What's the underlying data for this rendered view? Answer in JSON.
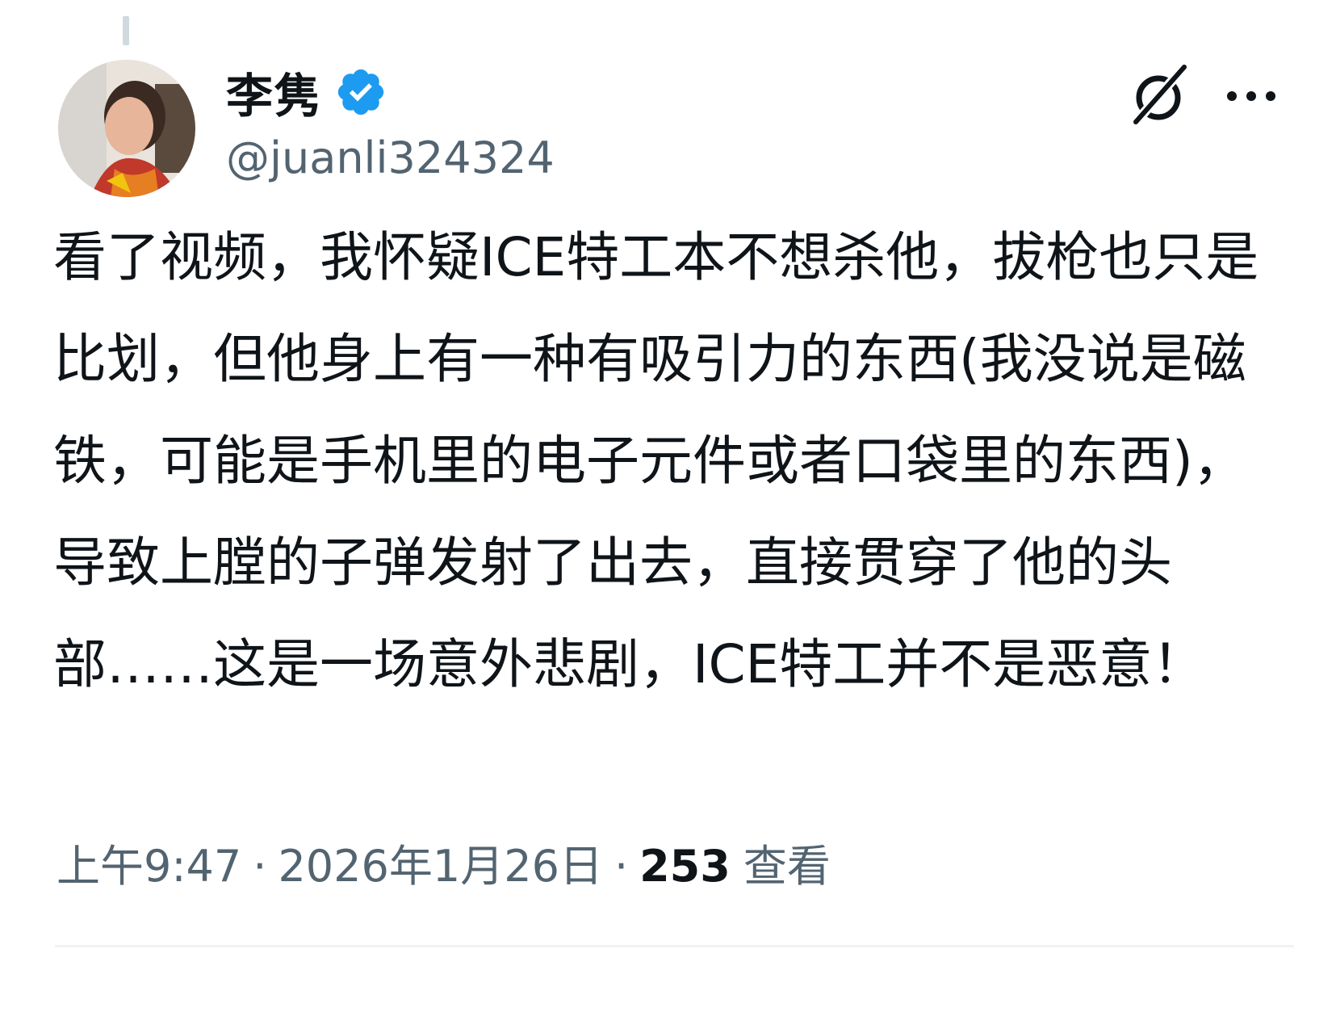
{
  "tweet": {
    "author": {
      "display_name": "李隽",
      "handle": "@juanli324324",
      "verified": true,
      "avatar_icon": "avatar-photo"
    },
    "text": "看了视频，我怀疑ICE特工本不想杀他，拔枪也只是比划，但他身上有一种有吸引力的东西(我没说是磁铁，可能是手机里的电子元件或者口袋里的东西)，导致上膛的子弹发射了出去，直接贯穿了他的头部……这是一场意外悲剧，ICE特工并不是恶意！",
    "time": "上午9:47",
    "separator": "·",
    "date": "2026年1月26日",
    "views_count": "253",
    "views_label": "查看"
  },
  "actions": {
    "grok_icon": "grok-icon",
    "more_icon": "more-options-icon"
  },
  "colors": {
    "text_primary": "#0f1419",
    "text_secondary": "#536471",
    "verified_blue": "#1d9bf0",
    "divider": "#eff3f4"
  }
}
